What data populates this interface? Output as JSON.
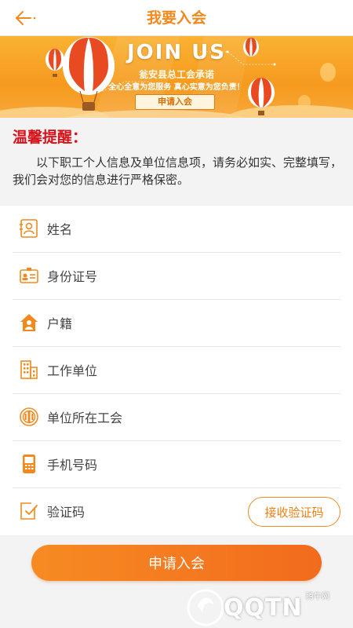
{
  "header": {
    "title": "我要入会",
    "back_icon": "arrow-left-icon"
  },
  "banner": {
    "headline": "JOIN US",
    "subtitle": "瓮安县总工会承诺",
    "slogan": "全心全意为您服务   真心实意为您负责！",
    "button_label": "申请入会"
  },
  "notice": {
    "title": "温馨提醒：",
    "text": "以下职工个人信息及单位信息项，请务必如实、完整填写，我们会对您的信息进行严格保密。"
  },
  "form": {
    "fields": [
      {
        "placeholder": "姓名",
        "icon": "id-badge-icon"
      },
      {
        "placeholder": "身份证号",
        "icon": "id-card-icon"
      },
      {
        "placeholder": "户籍",
        "icon": "house-icon"
      },
      {
        "placeholder": "工作单位",
        "icon": "building-icon"
      },
      {
        "placeholder": "单位所在工会",
        "icon": "union-emblem-icon"
      },
      {
        "placeholder": "手机号码",
        "icon": "phone-icon"
      },
      {
        "placeholder": "验证码",
        "icon": "verify-code-icon"
      }
    ],
    "code_button_label": "接收验证码"
  },
  "submit_label": "申请入会",
  "watermark": {
    "text": "QQTN",
    "small": "腾牛网"
  },
  "colors": {
    "accent": "#f08a1f",
    "notice_title": "#d8121b",
    "submit_start": "#f78b22",
    "submit_end": "#f26b1d"
  }
}
